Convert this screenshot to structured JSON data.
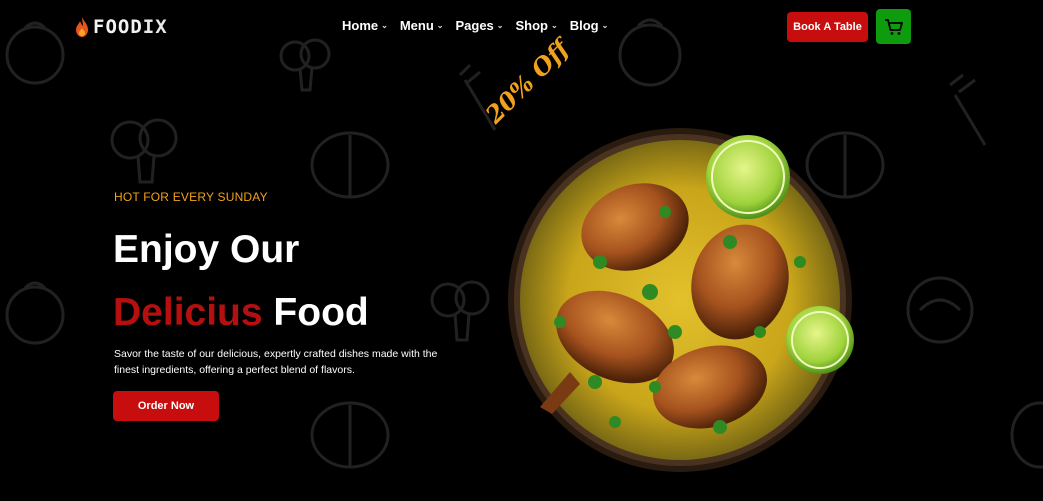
{
  "brand": {
    "logo_part1": "FOOD",
    "logo_part2": "IX"
  },
  "nav": {
    "items": [
      {
        "label": "Home"
      },
      {
        "label": "Menu"
      },
      {
        "label": "Pages"
      },
      {
        "label": "Shop"
      },
      {
        "label": "Blog"
      }
    ]
  },
  "header": {
    "book_label": "Book A Table",
    "cart_icon": "shopping-cart-icon"
  },
  "hero": {
    "eyebrow": "HOT FOR EVERY SUNDAY",
    "heading_line1": "Enjoy Our",
    "heading_red": "Delicius",
    "heading_white": "Food",
    "description": "Savor the taste of our delicious, expertly crafted dishes made with the finest ingredients, offering a perfect blend of flavors.",
    "cta_label": "Order Now",
    "promo": "20% Off"
  },
  "colors": {
    "accent_red": "#c70d0d",
    "accent_green": "#0e9b0e",
    "accent_gold": "#f0a11e",
    "background": "#000000"
  }
}
